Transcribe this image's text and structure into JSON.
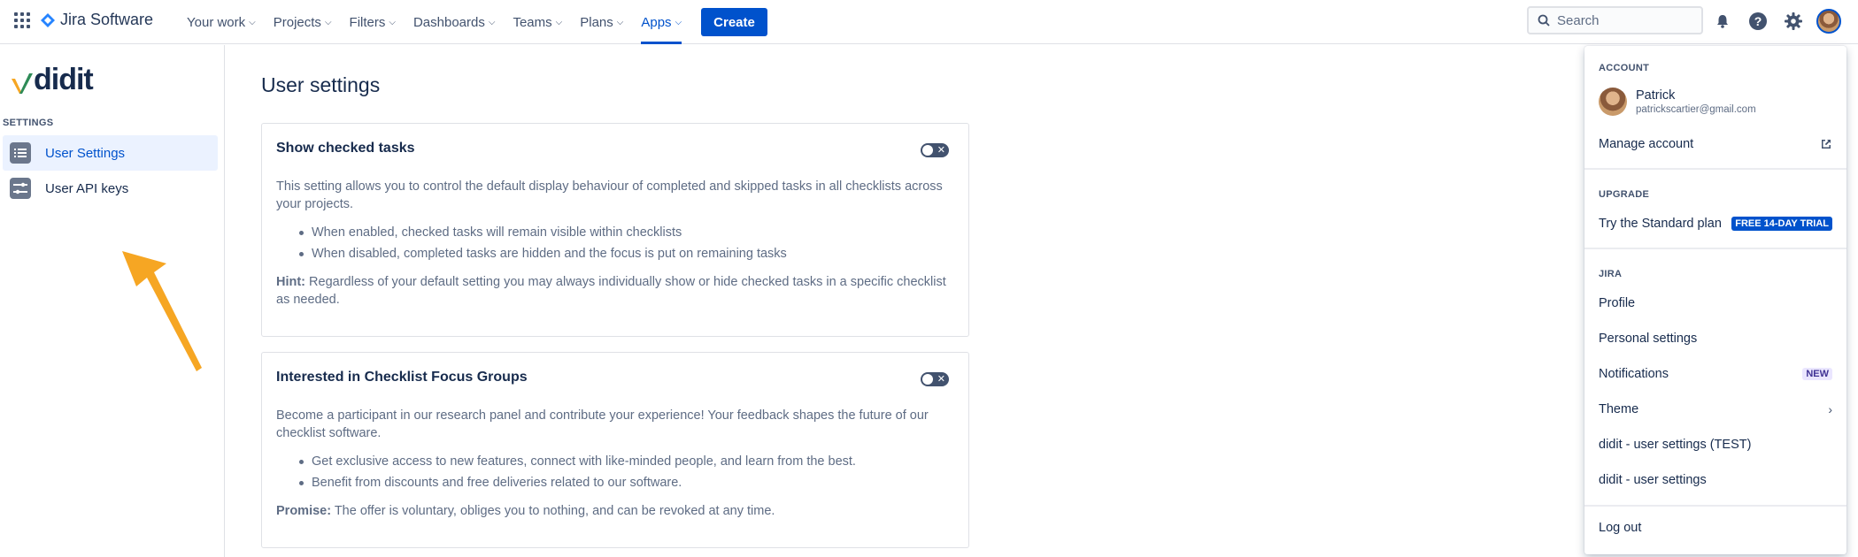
{
  "topnav": {
    "product_name": "Jira Software",
    "items": [
      {
        "label": "Your work"
      },
      {
        "label": "Projects"
      },
      {
        "label": "Filters"
      },
      {
        "label": "Dashboards"
      },
      {
        "label": "Teams"
      },
      {
        "label": "Plans"
      },
      {
        "label": "Apps",
        "active": true
      }
    ],
    "create_label": "Create",
    "search_placeholder": "Search",
    "accent": "#0052cc"
  },
  "sidebar": {
    "brand": "didit",
    "section_header": "SETTINGS",
    "items": [
      {
        "label": "User Settings",
        "selected": true,
        "icon": "list-icon"
      },
      {
        "label": "User API keys",
        "selected": false,
        "icon": "sliders-icon"
      }
    ],
    "annotation_color": "#f6a623"
  },
  "main": {
    "title": "User settings",
    "cards": [
      {
        "title": "Show checked tasks",
        "toggle_on": false,
        "intro": "This setting allows you to control the default display behaviour of completed and skipped tasks in all checklists across your projects.",
        "bullets": [
          "When enabled, checked tasks will remain visible within checklists",
          "When disabled, completed tasks are hidden and the focus is put on remaining tasks"
        ],
        "note_label": "Hint:",
        "note_text": " Regardless of your default setting you may always individually show or hide checked tasks in a specific checklist as needed."
      },
      {
        "title": "Interested in Checklist Focus Groups",
        "toggle_on": false,
        "intro": "Become a participant in our research panel and contribute your experience! Your feedback shapes the future of our checklist software.",
        "bullets": [
          "Get exclusive access to new features, connect with like-minded people, and learn from the best.",
          "Benefit from discounts and free deliveries related to our software."
        ],
        "note_label": "Promise:",
        "note_text": " The offer is voluntary, obliges you to nothing, and can be revoked at any time."
      }
    ]
  },
  "dropdown": {
    "account_header": "ACCOUNT",
    "user_name": "Patrick",
    "user_email": "patrickscartier@gmail.com",
    "manage_account": "Manage account",
    "upgrade_header": "UPGRADE",
    "upgrade_item": "Try the Standard plan",
    "trial_badge": "FREE 14-DAY TRIAL",
    "jira_header": "JIRA",
    "profile": "Profile",
    "personal_settings": "Personal settings",
    "notifications": "Notifications",
    "new_badge": "NEW",
    "theme": "Theme",
    "didit_test": "didit - user settings (TEST)",
    "didit_settings": "didit - user settings",
    "log_out": "Log out"
  }
}
